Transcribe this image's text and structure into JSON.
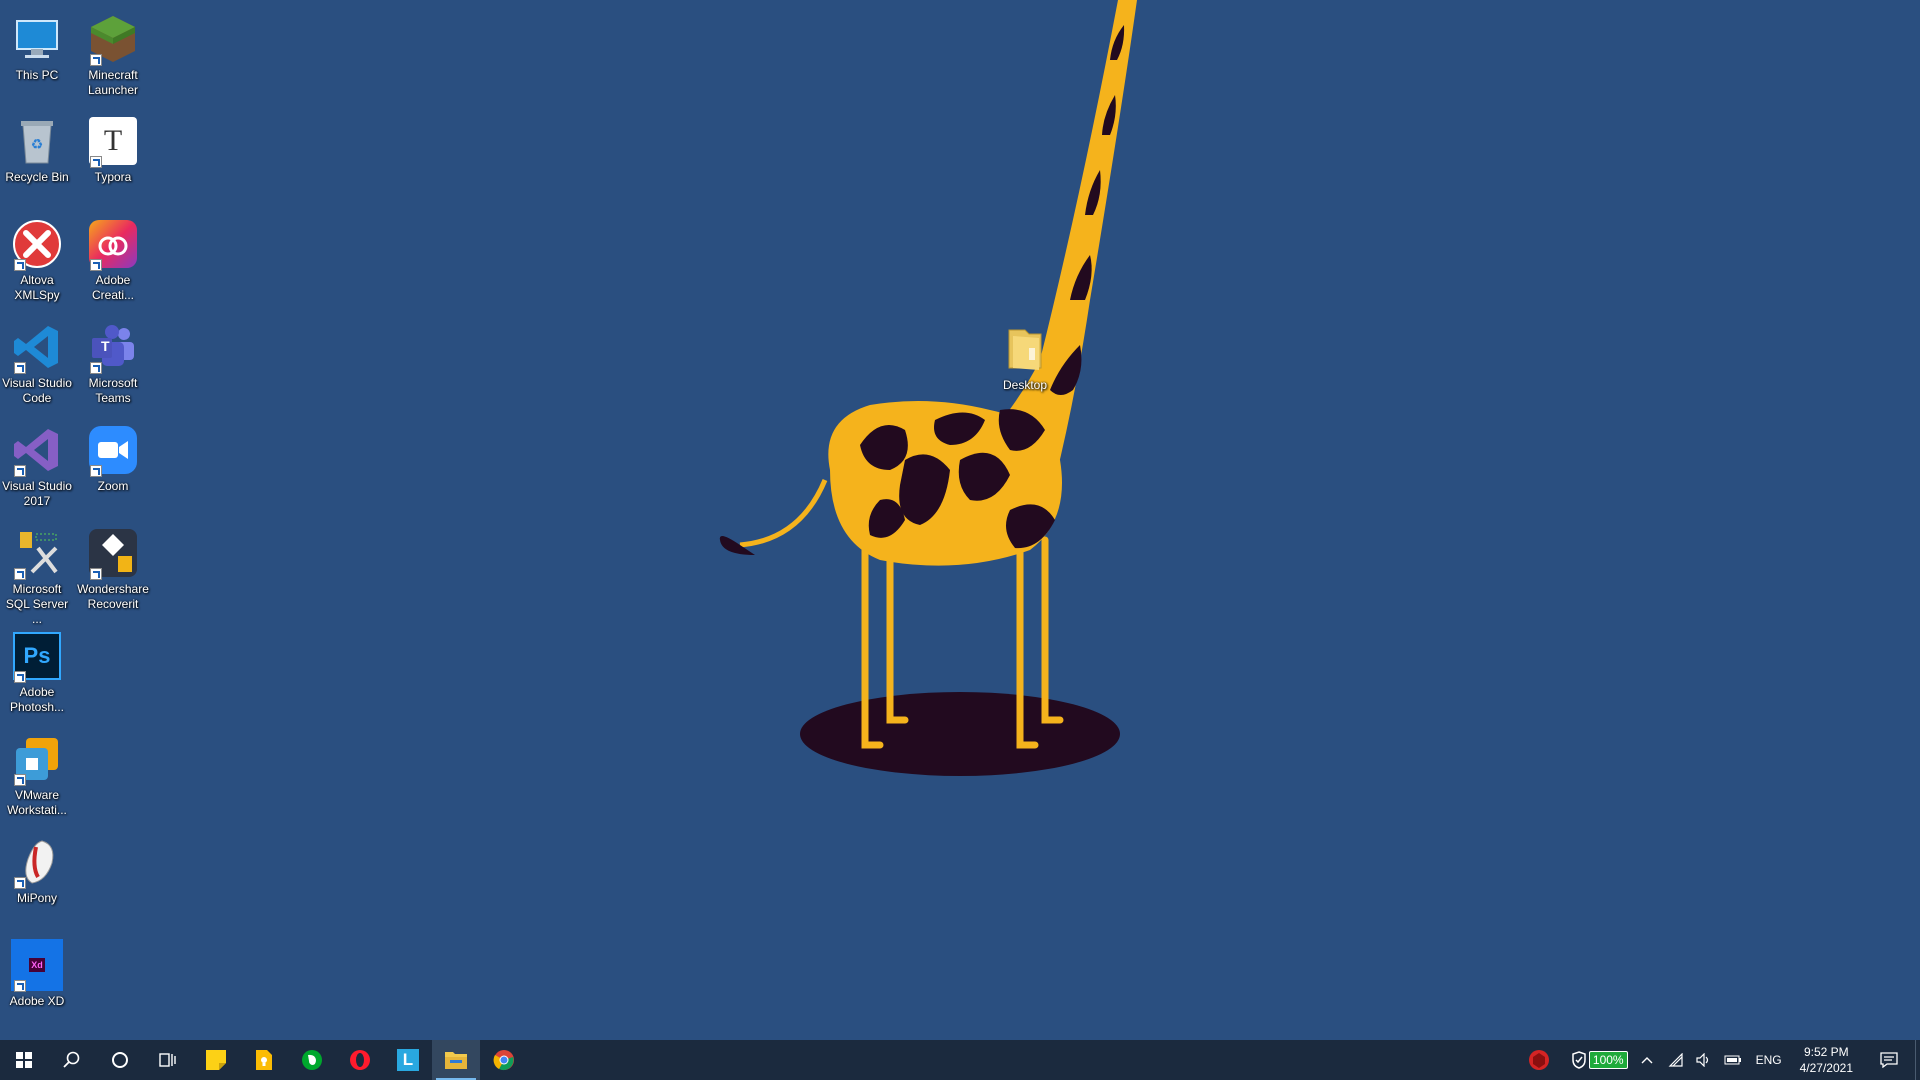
{
  "desktop": {
    "icons": [
      {
        "label": "This PC"
      },
      {
        "label": "Minecraft Launcher"
      },
      {
        "label": "Recycle Bin"
      },
      {
        "label": "Typora"
      },
      {
        "label": "Altova XMLSpy"
      },
      {
        "label": "Adobe Creati..."
      },
      {
        "label": "Visual Studio Code"
      },
      {
        "label": "Microsoft Teams"
      },
      {
        "label": "Visual Studio 2017"
      },
      {
        "label": "Zoom"
      },
      {
        "label": "Microsoft SQL Server ..."
      },
      {
        "label": "Wondershare Recoverit"
      },
      {
        "label": "Adobe Photosh..."
      },
      {
        "label": "VMware Workstati..."
      },
      {
        "label": "MiPony"
      },
      {
        "label": "Adobe XD"
      },
      {
        "label": "Desktop"
      }
    ],
    "typora_glyph": "T",
    "teams_glyph": "T",
    "photoshop_glyph": "Ps",
    "xd_glyph": "Xd"
  },
  "taskbar": {
    "apps": [
      "start-icon",
      "search-icon",
      "cortana-icon",
      "task-view-icon",
      "sticky-notes-icon",
      "google-keep-icon",
      "evernote-icon",
      "opera-icon",
      "launcher-l-icon",
      "file-explorer-icon",
      "chrome-icon"
    ],
    "launcher_glyph": "L",
    "active_app": "file-explorer-icon"
  },
  "tray": {
    "battery_percent": "100%",
    "language": "ENG",
    "time": "9:52 PM",
    "date": "4/27/2021"
  },
  "colors": {
    "wallpaper": "#2a4f80",
    "giraffe_yellow": "#f5b31c",
    "giraffe_dark": "#220a1f",
    "taskbar": "#1b2a3e"
  }
}
